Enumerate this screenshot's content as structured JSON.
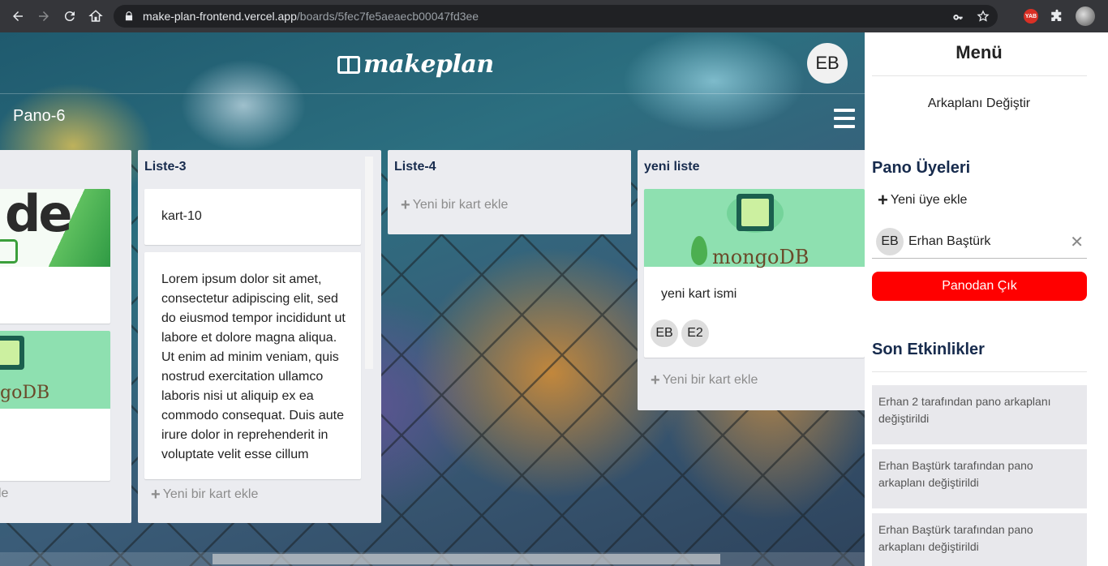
{
  "browser": {
    "url_host": "make-plan-frontend.vercel.app",
    "url_path": "/boards/5fec7fe5aeaecb00047fd3ee",
    "ext_badge": "YAB"
  },
  "header": {
    "logo_text": "makeplan",
    "user_initials": "EB",
    "board_title": "Pano-6"
  },
  "lists": [
    {
      "title": "",
      "add_label": "kle"
    },
    {
      "title": "Liste-3",
      "cards": [
        {
          "text": "kart-10"
        },
        {
          "text": "Lorem ipsum dolor sit amet, consectetur adipiscing elit, sed do eiusmod tempor incididunt ut labore et dolore magna aliqua. Ut enim ad minim veniam, quis nostrud exercitation ullamco laboris nisi ut aliquip ex ea commodo consequat. Duis aute irure dolor in reprehenderit in voluptate velit esse cillum"
        }
      ],
      "add_label": "Yeni bir kart ekle"
    },
    {
      "title": "Liste-4",
      "add_label": "Yeni bir kart ekle"
    },
    {
      "title": "yeni liste",
      "cards": [
        {
          "text": "yeni kart ismi",
          "image": "mongoDB",
          "members": [
            "EB",
            "E2"
          ]
        }
      ],
      "add_label": "Yeni bir kart ekle"
    }
  ],
  "card_images": {
    "node_text": "de",
    "mongo_text_partial": "goDB",
    "mongo_text": "mongoDB"
  },
  "menu": {
    "title": "Menü",
    "change_background": "Arkaplanı Değiştir",
    "members_title": "Pano Üyeleri",
    "add_member": "Yeni üye ekle",
    "members": [
      {
        "initials": "EB",
        "name": "Erhan Baştürk"
      }
    ],
    "leave_button": "Panodan Çık",
    "activities_title": "Son Etkinlikler",
    "activities": [
      "Erhan 2 tarafından pano arkaplanı değiştirildi",
      "Erhan Baştürk tarafından pano arkaplanı değiştirildi",
      "Erhan Baştürk tarafından pano arkaplanı değiştirildi"
    ]
  }
}
